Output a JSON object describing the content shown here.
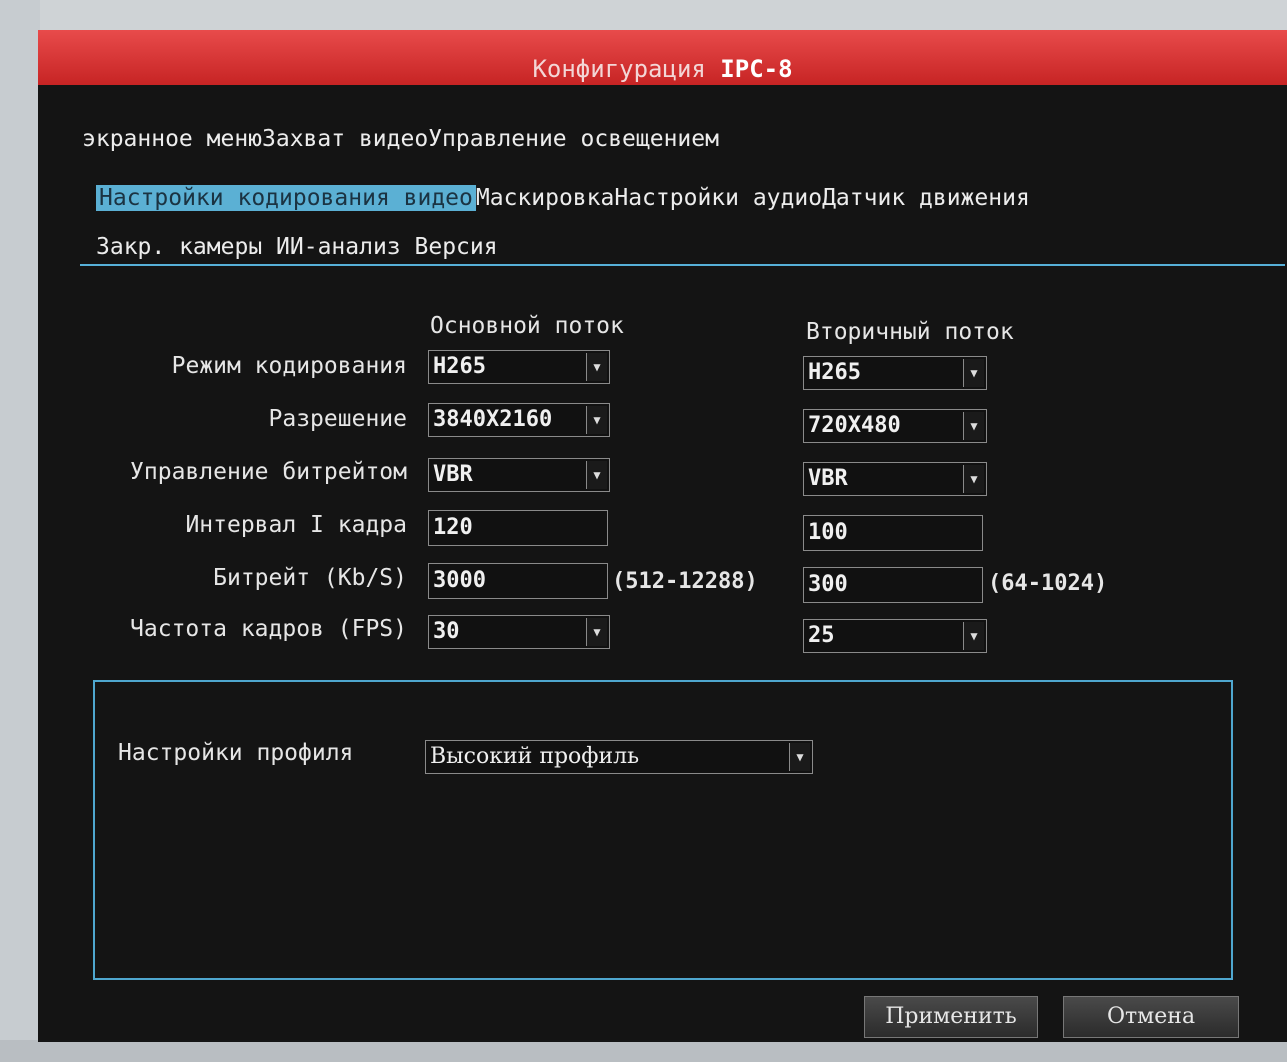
{
  "window": {
    "title_prefix": "Конфигурация",
    "title_device": "IPC-8"
  },
  "tabs": [
    [
      "экранное меню",
      "Захват видео",
      "Управление освещением"
    ],
    [
      "Настройки кодирования видео",
      "Маскировка",
      "Настройки аудио",
      "Датчик движения"
    ],
    [
      "Закр. камеры",
      "ИИ-анализ",
      "Версия"
    ]
  ],
  "active_tab": "Настройки кодирования видео",
  "columns": {
    "main": "Основной поток",
    "sub": "Вторичный поток"
  },
  "fields": {
    "encode_mode": {
      "label": "Режим кодирования",
      "main": "H265",
      "sub": "H265"
    },
    "resolution": {
      "label": "Разрешение",
      "main": "3840X2160",
      "sub": "720X480"
    },
    "bitrate_control": {
      "label": "Управление битрейтом",
      "main": "VBR",
      "sub": "VBR"
    },
    "iframe_interval": {
      "label": "Интервал I кадра",
      "main": "120",
      "sub": "100"
    },
    "bitrate": {
      "label": "Битрейт (Kb/S)",
      "main": "3000",
      "main_range": "(512-12288)",
      "sub": "300",
      "sub_range": "(64-1024)"
    },
    "fps": {
      "label": "Частота кадров (FPS)",
      "main": "30",
      "sub": "25"
    }
  },
  "profile": {
    "label": "Настройки профиля",
    "value": "Высокий профиль"
  },
  "buttons": {
    "apply": "Применить",
    "cancel": "Отмена"
  },
  "colors": {
    "titlebar": "#d63333",
    "accent": "#57b0d8",
    "background": "#141414"
  }
}
